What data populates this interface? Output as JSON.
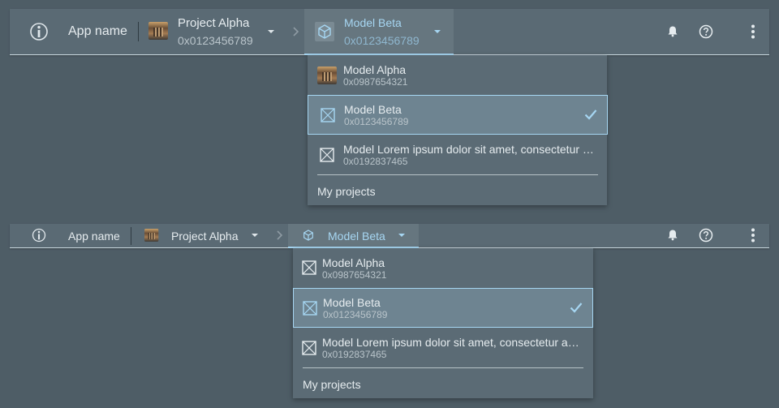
{
  "app": {
    "name": "App name"
  },
  "project": {
    "name": "Project Alpha",
    "id": "0x0123456789"
  },
  "model": {
    "name": "Model Beta",
    "id": "0x0123456789"
  },
  "menu": {
    "items": [
      {
        "name": "Model Alpha",
        "id": "0x0987654321"
      },
      {
        "name": "Model Beta",
        "id": "0x0123456789"
      },
      {
        "name": "Model Lorem ipsum dolor sit amet, consectetur adipiscing elit",
        "id": "0x0192837465"
      }
    ],
    "footer": "My projects"
  },
  "colors": {
    "bar": "#5a6a74",
    "accent": "#a6d6f2",
    "background": "#4e5d66",
    "selected_row": "#6e8491"
  },
  "icons": {
    "logo": "info-badge-icon",
    "breadcrumb_separator": "chevron-right-icon",
    "model": "cube-icon",
    "notifications": "bell-icon",
    "help": "help-circle-icon",
    "more": "more-vertical-icon",
    "selected": "check-icon",
    "placeholder": "image-placeholder-icon"
  }
}
